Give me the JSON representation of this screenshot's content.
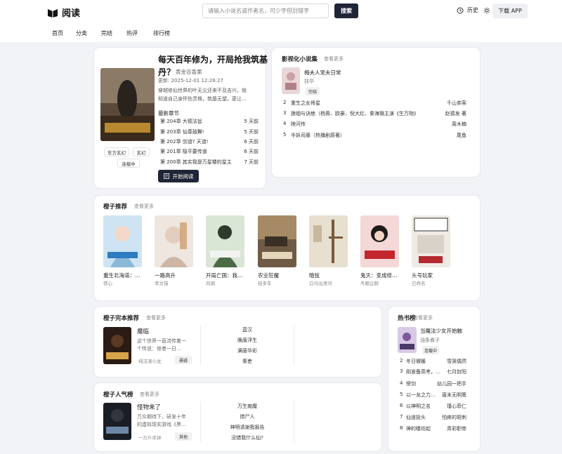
{
  "header": {
    "logo_text": "阅读",
    "search_placeholder": "请输入小说名或作者名，可少字但别错字",
    "search_button": "搜索",
    "history_label": "历史",
    "download_label": "下载 APP"
  },
  "nav": [
    {
      "label": "首页"
    },
    {
      "label": "分类"
    },
    {
      "label": "完结"
    },
    {
      "label": "热评"
    },
    {
      "label": "排行榜"
    }
  ],
  "featured": {
    "title_line1": "每天百年修为，开局抢我筑基",
    "title_line2": "丹？",
    "author": "黄金百香果",
    "updated": "更新: 2025-12-01 12:26:27",
    "description_line1": "穿越修仙世界的叶无尘还来不及吉兴，就",
    "description_line2": "知道自己身怀伤灵根，筑基无望。更让...",
    "chapters_heading": "最新章节",
    "chapters": [
      {
        "title": "第 204章 大德法旨",
        "time": "5 天前"
      },
      {
        "title": "第 203章 仙尊鼓舞!",
        "time": "5 天前"
      },
      {
        "title": "第 202章 剑谊? 天谊!",
        "time": "6 天前"
      },
      {
        "title": "第 201章 隐平要传道",
        "time": "6 天前"
      },
      {
        "title": "第 200章 其实我是万星楼的星主",
        "time": "7 天前"
      }
    ],
    "tags": [
      "东方玄幻",
      "玄幻"
    ],
    "status": "连载中",
    "read_button": "开始阅读"
  },
  "film": {
    "title": "影视化小说集",
    "see_more": "查看更多",
    "top_book": {
      "title": "梅夫人宠夫日常",
      "author": "扶华",
      "status": "完结"
    },
    "list": [
      {
        "rank": "2",
        "title": "重生之女将星",
        "author": "千山茶客"
      },
      {
        "rank": "3",
        "title": "狼烟与诀绝（杨蓉、欧豪、倪大红、秦海璐主演《生万物》",
        "author": "赵德发 著"
      },
      {
        "rank": "4",
        "title": "映河传",
        "author": "周木楠"
      },
      {
        "rank": "5",
        "title": "半妖司藤（热播剧原著）",
        "author": "尾鱼"
      }
    ]
  },
  "recommend": {
    "title": "橙子推荐",
    "see_more": "查看更多",
    "books": [
      {
        "title": "重生北海道：…",
        "author": "铁心"
      },
      {
        "title": "一路高升",
        "author": "孝文错"
      },
      {
        "title": "开局亡国：我…",
        "author": "风烟"
      },
      {
        "title": "农业狂魔",
        "author": "轻多车"
      },
      {
        "title": "暗弦",
        "author": "白马出清河"
      },
      {
        "title": "鬼灭：变成修…",
        "author": "冬眠企鹅"
      },
      {
        "title": "头号玩家",
        "author": "已命名"
      }
    ]
  },
  "finished": {
    "title": "橙子完本推荐",
    "see_more": "查看更多",
    "top_book": {
      "title": "魔临",
      "desc_line1": "这个世界一直流传着一",
      "desc_line2": "个传说：修者一日...",
      "author": "纯洁滴小龙",
      "button": "悬疑"
    },
    "list": [
      "蓝汉",
      "晚唐浮生",
      "满唐华彩",
      "秦吏"
    ]
  },
  "popular": {
    "title": "橙子人气榜",
    "see_more": "查看更多",
    "top_book": {
      "title": "怪物来了",
      "desc_line1": "万众期待下，研发十年",
      "desc_line2": "的虚拟现实游戏《黑...",
      "author": "一万斤吊钟",
      "button": "其他"
    },
    "list": [
      "万生痴魔",
      "捞尸人",
      "神明请谢我报告",
      "没错我什么仙?"
    ]
  },
  "hot": {
    "title": "热书榜",
    "see_more": "查看更多",
    "top_book": {
      "title": "当魔法少女开始触",
      "author": "油条煮子",
      "status": "连载中"
    },
    "list": [
      {
        "rank": "2",
        "title": "冬日微暖",
        "author": "雪哭偶然"
      },
      {
        "rank": "3",
        "title": "刚准备高考，…",
        "author": "七月封阳"
      },
      {
        "rank": "4",
        "title": "傍剑",
        "author": "幼儿园一把手"
      },
      {
        "rank": "5",
        "title": "以一龙之力…",
        "author": "唐末无明策"
      },
      {
        "rank": "6",
        "title": "以神明之名",
        "author": "瑾心菲仁"
      },
      {
        "rank": "7",
        "title": "仙道投头",
        "author": "怕疼的斑刺"
      },
      {
        "rank": "8",
        "title": "神的楼坊起",
        "author": "青彩职帝"
      }
    ]
  },
  "colors": {
    "accent": "#1f2436",
    "background": "#f1f3f6"
  }
}
